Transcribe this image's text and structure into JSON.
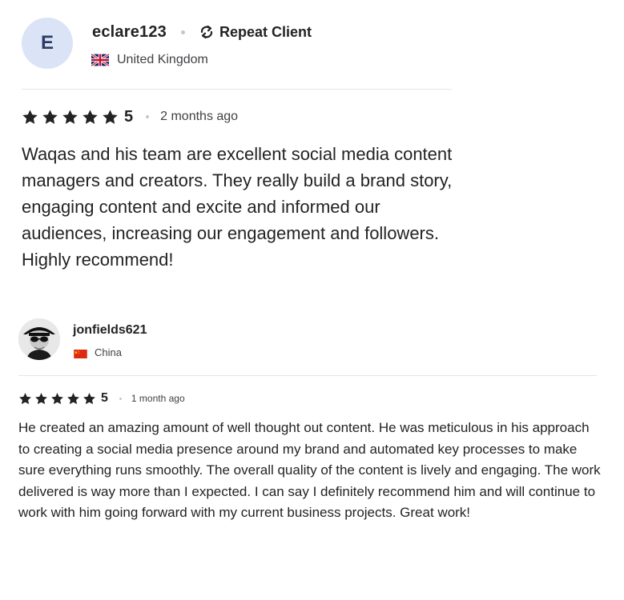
{
  "reviews": [
    {
      "avatar_letter": "E",
      "username": "eclare123",
      "badge_label": "Repeat Client",
      "badge_icon": "repeat-icon",
      "country": "United Kingdom",
      "flag_icon": "uk-flag-icon",
      "stars": 5,
      "rating": "5",
      "time_ago": "2 months ago",
      "text": "Waqas and his team are excellent social media content managers and creators. They really build a brand story, engaging content and excite and informed our audiences, increasing our engagement and followers. Highly recommend!"
    },
    {
      "avatar_icon": "user-photo-avatar",
      "username": "jonfields621",
      "country": "China",
      "flag_icon": "china-flag-icon",
      "stars": 5,
      "rating": "5",
      "time_ago": "1 month ago",
      "text": "He created an amazing amount of well thought out content. He was meticulous in his approach to creating a social media presence around my brand and automated key processes to make sure everything runs smoothly. The overall quality of the content is lively and engaging. The work delivered is way more than I expected. I can say I definitely recommend him and will continue to work with him going forward with my current business projects. Great work!"
    }
  ],
  "colors": {
    "star": "#222325",
    "text": "#222325",
    "muted": "#404145",
    "divider": "#e4e5e7",
    "avatar_bg": "#dbe4f7"
  }
}
